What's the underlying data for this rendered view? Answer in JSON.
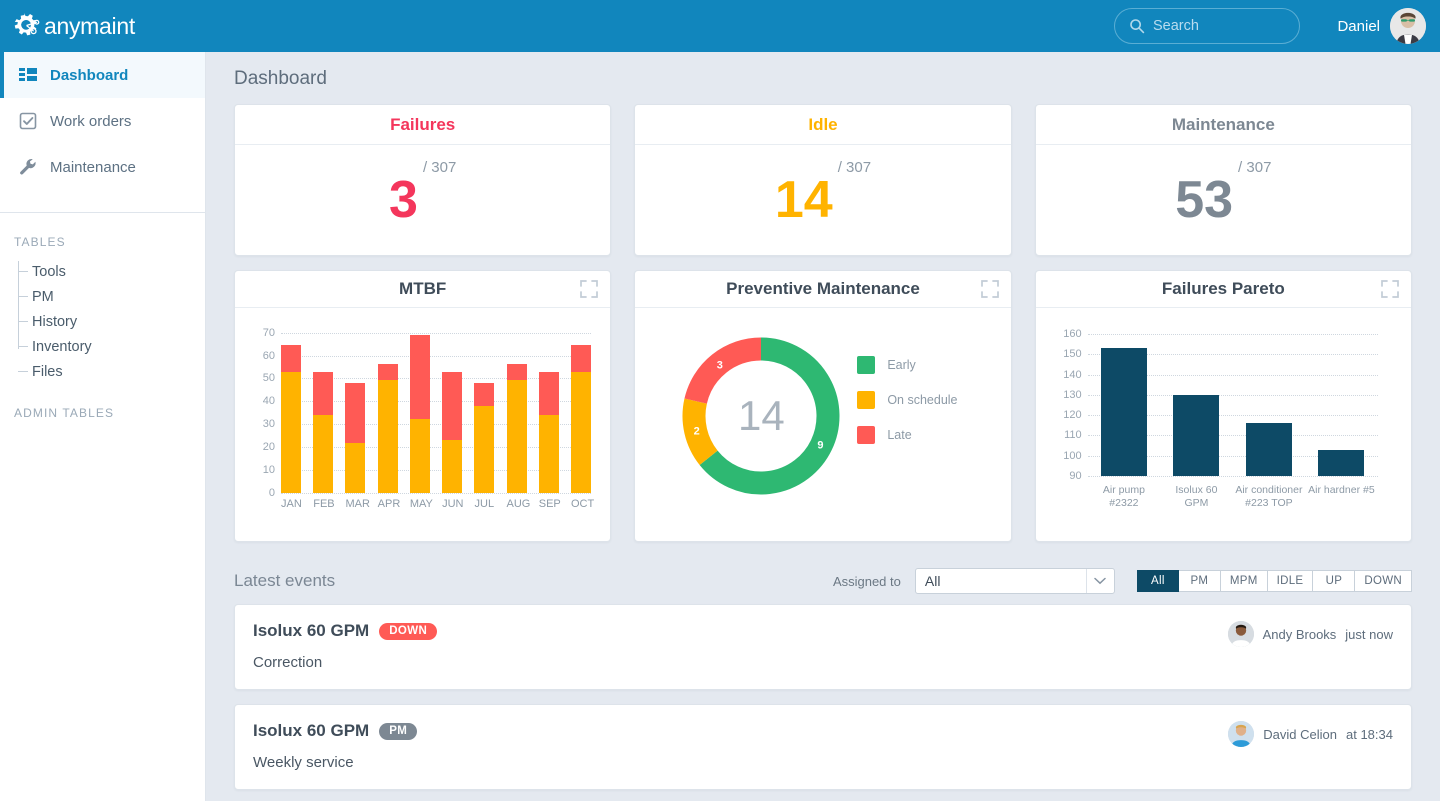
{
  "header": {
    "logo_text": "anymaint",
    "logo_icon": "gear-icon",
    "search_placeholder": "Search",
    "search_value": "",
    "search_icon": "search-icon",
    "user_name": "Daniel",
    "avatar_icon": "avatar"
  },
  "sidebar": {
    "nav": [
      {
        "label": "Dashboard",
        "icon": "dashboard-icon",
        "active": true
      },
      {
        "label": "Work orders",
        "icon": "checkbox-icon",
        "active": false
      },
      {
        "label": "Maintenance",
        "icon": "wrench-icon",
        "active": false
      }
    ],
    "tables_heading": "TABLES",
    "tables": [
      {
        "label": "Tools"
      },
      {
        "label": "PM"
      },
      {
        "label": "History"
      },
      {
        "label": "Inventory"
      },
      {
        "label": "Files"
      }
    ],
    "admin_heading": "ADMIN TABLES"
  },
  "main": {
    "page_title": "Dashboard",
    "kpis": [
      {
        "title": "Failures",
        "value": "3",
        "denominator": "/ 307",
        "color": "#f4365c"
      },
      {
        "title": "Idle",
        "value": "14",
        "denominator": "/ 307",
        "color": "#ffb300"
      },
      {
        "title": "Maintenance",
        "value": "53",
        "denominator": "/ 307",
        "color": "#7d8893"
      }
    ]
  },
  "chart_data": [
    {
      "type": "bar",
      "title": "MTBF",
      "stacked": true,
      "categories": [
        "JAN",
        "FEB",
        "MAR",
        "APR",
        "MAY",
        "JUN",
        "JUL",
        "AUG",
        "SEP",
        "OCT"
      ],
      "series": [
        {
          "name": "base",
          "color": "#ffb300",
          "values": [
            53,
            34,
            22,
            49.5,
            32.5,
            23,
            38,
            49.5,
            34,
            53
          ]
        },
        {
          "name": "top",
          "color": "#ff5a55",
          "values": [
            11.5,
            19,
            26,
            7,
            36.5,
            30,
            10,
            7,
            19,
            11.5
          ]
        }
      ],
      "totals": [
        64.5,
        53,
        48,
        56.5,
        69,
        53,
        48,
        56.5,
        53,
        64.5
      ],
      "yticks": [
        0,
        10,
        20,
        30,
        40,
        50,
        60,
        70
      ],
      "ylim": [
        0,
        72
      ],
      "xlabel": "",
      "ylabel": "",
      "grid": true,
      "expand_icon": "expand-icon"
    },
    {
      "type": "pie",
      "title": "Preventive Maintenance",
      "center_value": "14",
      "labels": [
        "Early",
        "On schedule",
        "Late"
      ],
      "values": [
        9,
        2,
        3
      ],
      "colors": [
        "#2eb872",
        "#ffb300",
        "#ff5a55"
      ],
      "legend_position": "right",
      "expand_icon": "expand-icon"
    },
    {
      "type": "bar",
      "title": "Failures Pareto",
      "categories": [
        "Air pump #2322",
        "Isolux 60 GPM",
        "Air conditioner #223 TOP",
        "Air hardner #5"
      ],
      "category_lines": [
        [
          "Air pump",
          "#2322"
        ],
        [
          "Isolux 60",
          "GPM"
        ],
        [
          "Air conditioner",
          "#223 TOP"
        ],
        [
          "Air hardner #5",
          ""
        ]
      ],
      "values": [
        153,
        130,
        116,
        103
      ],
      "color": "#0d4a66",
      "yticks": [
        90,
        100,
        110,
        120,
        130,
        140,
        150,
        160
      ],
      "ylim": [
        90,
        163
      ],
      "xlabel": "",
      "ylabel": "",
      "grid": true,
      "expand_icon": "expand-icon"
    }
  ],
  "events": {
    "heading": "Latest events",
    "assigned_label": "Assigned to",
    "assigned_value": "All",
    "dropdown_icon": "chevron-down-icon",
    "filters": [
      {
        "label": "All",
        "active": true
      },
      {
        "label": "PM",
        "active": false
      },
      {
        "label": "MPM",
        "active": false
      },
      {
        "label": "IDLE",
        "active": false
      },
      {
        "label": "UP",
        "active": false
      },
      {
        "label": "DOWN",
        "active": false
      }
    ],
    "items": [
      {
        "name": "Isolux 60 GPM",
        "badge": "DOWN",
        "badge_color": "#ff5a55",
        "description": "Correction",
        "user": "Andy Brooks",
        "time": "just now"
      },
      {
        "name": "Isolux 60 GPM",
        "badge": "PM",
        "badge_color": "#7d8893",
        "description": "Weekly service",
        "user": "David Celion",
        "time": "at 18:34"
      }
    ]
  }
}
